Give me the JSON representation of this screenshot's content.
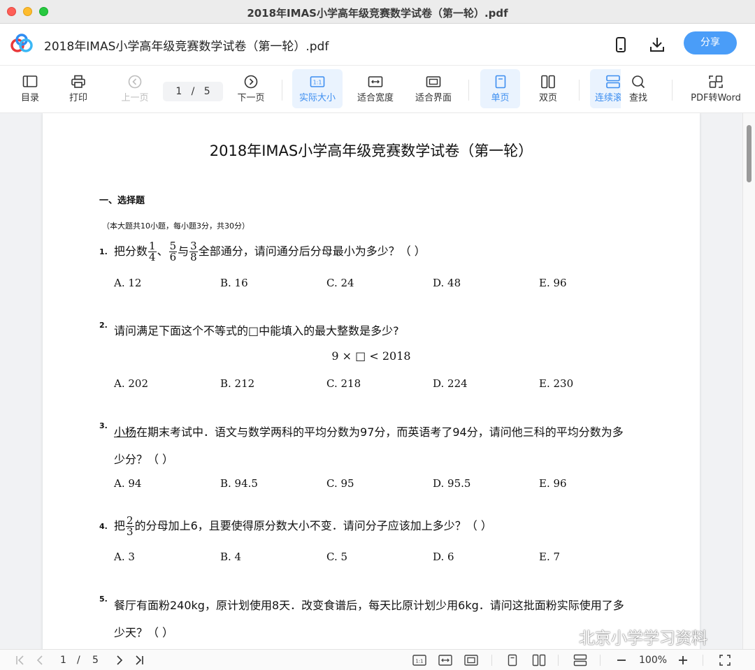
{
  "window": {
    "title": "2018年IMAS小学高年级竞赛数学试卷（第一轮）.pdf"
  },
  "header": {
    "doc_title": "2018年IMAS小学高年级竞赛数学试卷（第一轮）.pdf",
    "share_label": "分享",
    "icons": [
      "app-logo-icon",
      "phone-icon",
      "download-icon"
    ],
    "accent_color": "#4a9df8"
  },
  "toolbar": {
    "toc": "目录",
    "print": "打印",
    "prev_page": "上一页",
    "page_current": "1",
    "page_sep": "/",
    "page_total": "5",
    "next_page": "下一页",
    "actual_size": "实际大小",
    "fit_width": "适合宽度",
    "fit_page": "适合界面",
    "single_page": "单页",
    "double_page": "双页",
    "continuous": "连续滚",
    "search": "查找",
    "pdf_to_word": "PDF转Word"
  },
  "document": {
    "title": "2018年IMAS小学高年级竞赛数学试卷（第一轮）",
    "section": "一、选择题",
    "section_note": "（本大题共10小题，每小题3分，共30分）",
    "questions": [
      {
        "num": "1.",
        "prefix": "把分数",
        "f1_num": "1",
        "f1_den": "4",
        "sep1": "、",
        "f2_num": "5",
        "f2_den": "6",
        "sep2": "与",
        "f3_num": "3",
        "f3_den": "8",
        "suffix": "全部通分，请问通分后分母最小为多少？（    ）",
        "options": [
          "A. 12",
          "B. 16",
          "C. 24",
          "D. 48",
          "E. 96"
        ]
      },
      {
        "num": "2.",
        "text": "请问满足下面这个不等式的□中能填入的最大整数是多少?",
        "formula": "9 × □ < 2018",
        "options": [
          "A. 202",
          "B. 212",
          "C. 218",
          "D. 224",
          "E. 230"
        ]
      },
      {
        "num": "3.",
        "name": "小杨",
        "line1_rest": "在期末考试中．语文与数学两科的平均分数为97分，而英语考了94分，请问他三科的平均分数为多",
        "line2": "少分？（    ）",
        "options": [
          "A. 94",
          "B. 94.5",
          "C. 95",
          "D. 95.5",
          "E. 96"
        ]
      },
      {
        "num": "4.",
        "prefix": "把",
        "f_num": "2",
        "f_den": "3",
        "suffix": "的分母加上6，且要使得原分数大小不变．请问分子应该加上多少？（    ）",
        "options": [
          "A. 3",
          "B. 4",
          "C. 5",
          "D. 6",
          "E. 7"
        ]
      },
      {
        "num": "5.",
        "line1": "餐厅有面粉240kg，原计划使用8天．改变食谱后，每天比原计划少用6kg．请问这批面粉实际使用了多",
        "line2": "少天？（    ）"
      }
    ]
  },
  "watermark": {
    "text": "北京小学学习资料"
  },
  "bottombar": {
    "page_current": "1",
    "page_sep": "/",
    "page_total": "5",
    "zoom": "100%"
  }
}
